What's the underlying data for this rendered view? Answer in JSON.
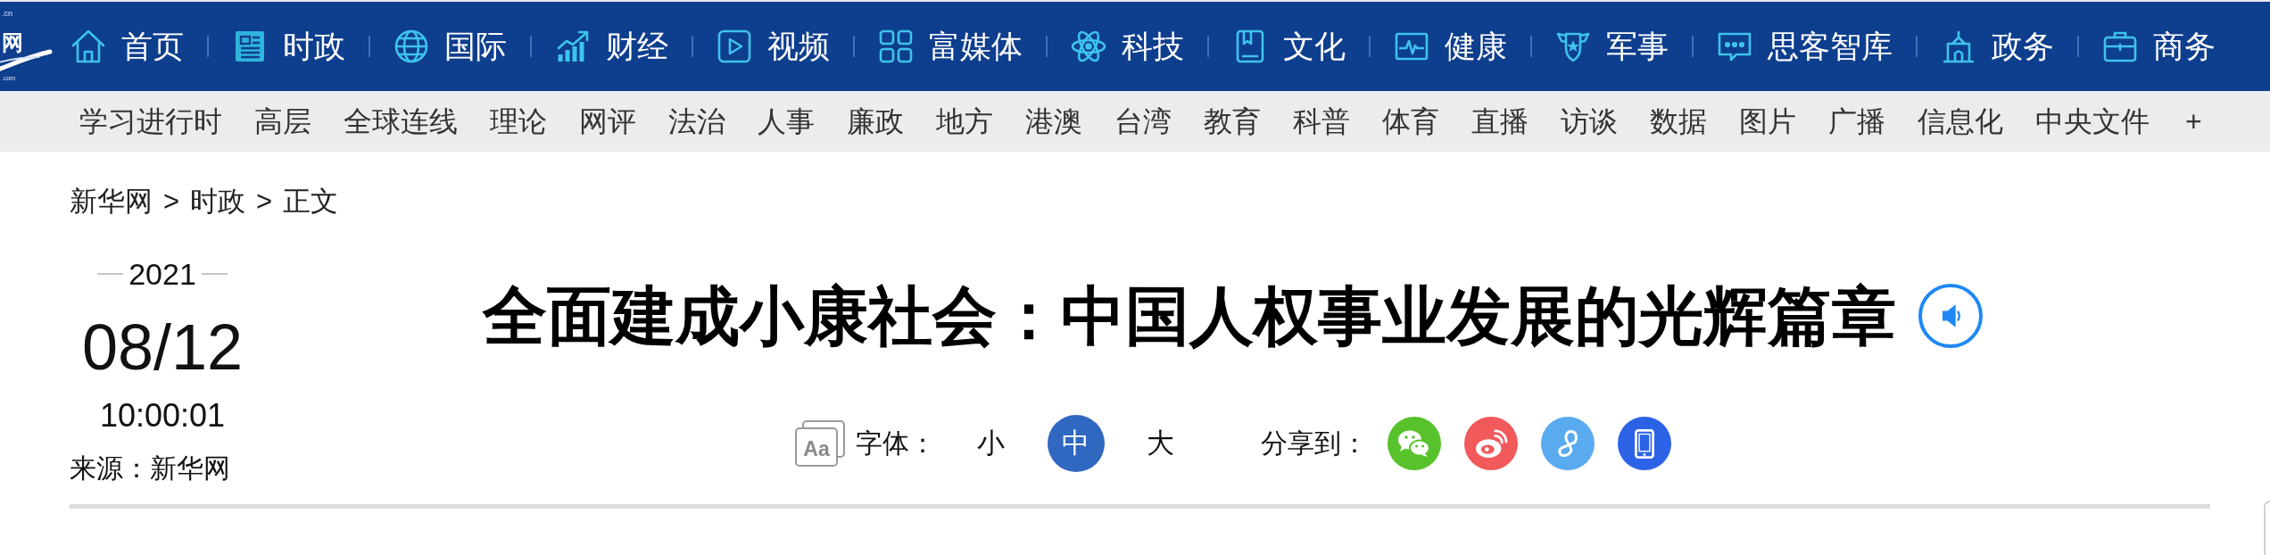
{
  "logo": {
    "domain": ".cn",
    "mark": "网",
    "suffix": ".com"
  },
  "main_nav": [
    "首页",
    "时政",
    "国际",
    "财经",
    "视频",
    "富媒体",
    "科技",
    "文化",
    "健康",
    "军事",
    "思客智库",
    "政务",
    "商务"
  ],
  "channel_nav": {
    "items": [
      "学习进行时",
      "高层",
      "全球连线",
      "理论",
      "网评",
      "法治",
      "人事",
      "廉政",
      "地方",
      "港澳",
      "台湾",
      "教育",
      "科普",
      "体育",
      "直播",
      "访谈",
      "数据",
      "图片",
      "广播",
      "信息化",
      "中央文件"
    ],
    "more": "+"
  },
  "breadcrumb": {
    "items": [
      "新华网",
      "时政",
      "正文"
    ],
    "separators": [
      ">",
      ">"
    ]
  },
  "dateline": {
    "year": "2021",
    "date": "08/12",
    "time": "10:00:01",
    "source": "来源：新华网"
  },
  "article": {
    "title": "全面建成小康社会：中国人权事业发展的光辉篇章",
    "font_size": {
      "icon_text": "Aa",
      "label": "字体：",
      "options": [
        {
          "label": "小",
          "selected": false
        },
        {
          "label": "中",
          "selected": true
        },
        {
          "label": "大",
          "selected": false
        }
      ]
    },
    "share": {
      "label": "分享到：",
      "buttons": [
        {
          "color": "#57c22b"
        },
        {
          "color": "#f2595a"
        },
        {
          "color": "#5aaaf0"
        },
        {
          "color": "#2b62e6"
        }
      ]
    }
  }
}
